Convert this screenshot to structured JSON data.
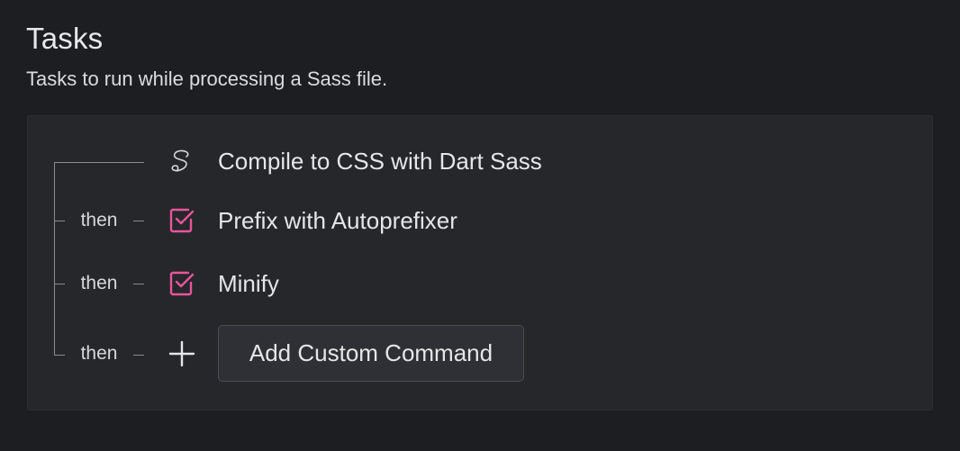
{
  "section": {
    "title": "Tasks",
    "description": "Tasks to run while processing a Sass file."
  },
  "tasks": [
    {
      "connector": "",
      "icon": "sass-logo-icon",
      "label": "Compile to CSS with Dart Sass"
    },
    {
      "connector": "then",
      "icon": "checkbox-checked-icon",
      "label": "Prefix with Autoprefixer",
      "checked": true
    },
    {
      "connector": "then",
      "icon": "checkbox-checked-icon",
      "label": "Minify",
      "checked": true
    }
  ],
  "add_row": {
    "connector": "then",
    "icon": "plus-icon",
    "button_label": "Add Custom Command"
  },
  "colors": {
    "accent": "#e9559b",
    "background": "#1c1e22",
    "panel": "#25272b"
  }
}
